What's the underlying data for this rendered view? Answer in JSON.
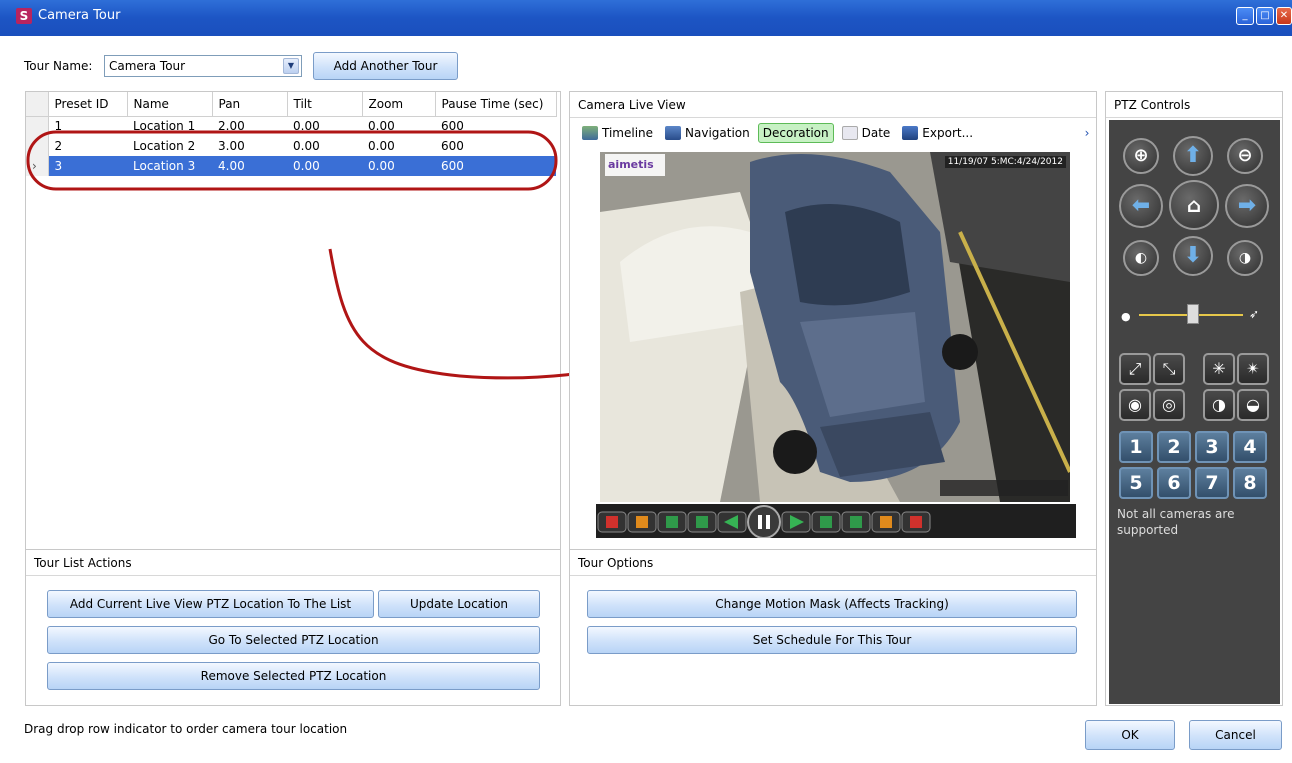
{
  "window": {
    "title": "Camera Tour",
    "app_icon": "S"
  },
  "tour_name": {
    "label": "Tour Name:",
    "value": "Camera Tour",
    "add_button": "Add Another Tour"
  },
  "table": {
    "columns": [
      "Preset ID",
      "Name",
      "Pan",
      "Tilt",
      "Zoom",
      "Pause Time (sec)"
    ],
    "rows": [
      [
        "1",
        "Location 1",
        "2.00",
        "0.00",
        "0.00",
        "600"
      ],
      [
        "2",
        "Location 2",
        "3.00",
        "0.00",
        "0.00",
        "600"
      ],
      [
        "3",
        "Location 3",
        "4.00",
        "0.00",
        "0.00",
        "600"
      ]
    ],
    "selected_index": 2
  },
  "live_view": {
    "title": "Camera Live View",
    "toolbar": [
      "Timeline",
      "Navigation",
      "Decoration",
      "Date",
      "Export..."
    ],
    "logo": "aimetis",
    "timestamp": "11/19/07 5:MC:4/24/2012"
  },
  "ptz": {
    "title": "PTZ Controls",
    "presets": [
      "1",
      "2",
      "3",
      "4",
      "5",
      "6",
      "7",
      "8"
    ],
    "note": "Not all cameras are supported"
  },
  "tour_list_actions": {
    "title": "Tour List Actions",
    "add_current": "Add Current Live View PTZ Location To The List",
    "update": "Update Location",
    "go_to": "Go To Selected PTZ Location",
    "remove": "Remove Selected PTZ Location"
  },
  "tour_options": {
    "title": "Tour Options",
    "change_mask": "Change Motion Mask (Affects Tracking)",
    "schedule": "Set Schedule For This Tour"
  },
  "footer": {
    "hint": "Drag  drop row indicator to order camera tour location",
    "ok": "OK",
    "cancel": "Cancel"
  },
  "colors": {
    "title_bar": "#1d55c4",
    "selection": "#3a6fd6",
    "annotation": "#b01515",
    "ptz_bg": "#444444"
  }
}
